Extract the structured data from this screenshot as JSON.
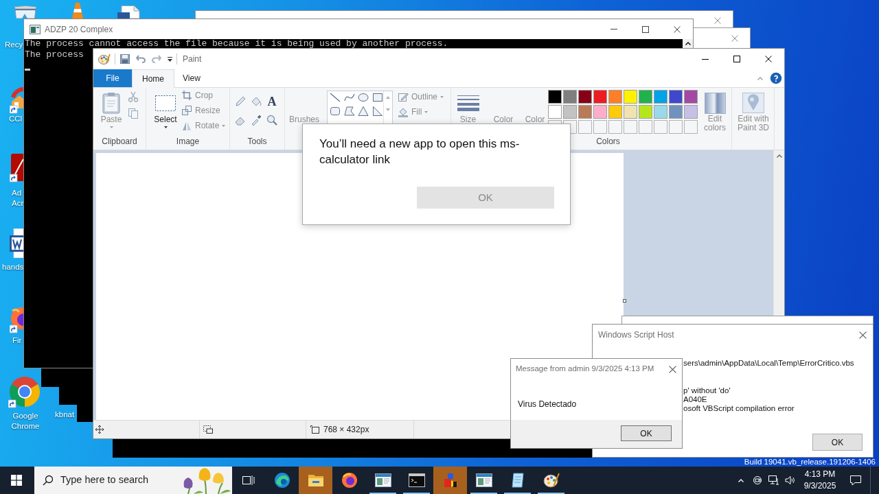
{
  "desktop": {
    "icons": [
      {
        "kind": "bin",
        "label_lines": [
          "Recy"
        ]
      },
      {
        "kind": "cone"
      },
      {
        "kind": "document"
      },
      {
        "kind": "cleaner",
        "label_lines": [
          "CCl"
        ]
      },
      {
        "kind": "pdf",
        "label_lines": [
          "Ad",
          "Acr"
        ]
      },
      {
        "kind": "word",
        "label_lines": [
          "hands"
        ]
      },
      {
        "kind": "fox",
        "label_lines": [
          "Fir"
        ]
      },
      {
        "kind": "chrome",
        "label_lines": [
          "Google",
          "Chrome"
        ]
      },
      {
        "kind": "file",
        "label_lines": [
          "kbnat"
        ]
      }
    ],
    "build_text": "Build 19041.vb_release.191206-1406"
  },
  "console": {
    "title": "ADZP 20 Complex",
    "lines": [
      "The process cannot access the file because it is being used by another process.",
      "The process"
    ]
  },
  "paint": {
    "title": "Paint",
    "file_tab": "File",
    "tabs": [
      {
        "label": "Home",
        "selected": true
      },
      {
        "label": "View",
        "selected": false
      }
    ],
    "clipboard": {
      "label": "Clipboard",
      "paste": {
        "label": "Paste",
        "disabled": true
      }
    },
    "image": {
      "label": "Image",
      "select": {
        "label": "Select",
        "disabled": false
      },
      "buttons": [
        {
          "kind": "crop",
          "label": "Crop",
          "disabled": true
        },
        {
          "kind": "resize",
          "label": "Resize",
          "disabled": true
        },
        {
          "kind": "rotate",
          "label": "Rotate",
          "disabled": true
        }
      ]
    },
    "tools": {
      "label": "Tools",
      "text_glyph": "A"
    },
    "brushes": {
      "label": "Brushes"
    },
    "shapes": {
      "buttons": [
        {
          "kind": "outline",
          "label": "Outline",
          "disabled": true
        },
        {
          "kind": "fill",
          "label": "Fill",
          "disabled": true
        }
      ]
    },
    "size": {
      "label": "Size"
    },
    "color_labels": [
      "Color",
      "Color"
    ],
    "colors": {
      "label": "Colors",
      "swatches": [
        {
          "color": "#000000"
        },
        {
          "color": "#7f7f7f"
        },
        {
          "color": "#880015"
        },
        {
          "color": "#ed1c24"
        },
        {
          "color": "#ff7f27"
        },
        {
          "color": "#fff200"
        },
        {
          "color": "#22b14c"
        },
        {
          "color": "#00a2e8"
        },
        {
          "color": "#3f48cc"
        },
        {
          "color": "#a349a4"
        },
        {
          "color": "#ffffff"
        },
        {
          "color": "#c3c3c3"
        },
        {
          "color": "#b97a57"
        },
        {
          "color": "#ffaec9"
        },
        {
          "color": "#ffc90e"
        },
        {
          "color": "#efe4b0"
        },
        {
          "color": "#b5e61d"
        },
        {
          "color": "#99d9ea"
        },
        {
          "color": "#7092be"
        },
        {
          "color": "#c8bfe7"
        }
      ]
    },
    "edit_colors": "Edit colors",
    "paint3d": "Edit with Paint 3D",
    "status": {
      "canvas_size": "768 × 432px"
    }
  },
  "app_dialog": {
    "message": "You’ll need a new app to open this ms-calculator link",
    "ok": {
      "label": "OK",
      "disabled": true
    }
  },
  "script_host": {
    "title": "Windows Script Host",
    "lines": [
      "sers\\admin\\AppData\\Local\\Temp\\ErrorCritico.vbs",
      "p' without 'do'",
      "A040E",
      "osoft VBScript compilation error"
    ],
    "button": "OK"
  },
  "message_box": {
    "title": "Message from admin 9/3/2025 4:13 PM",
    "text": "Virus Detectado",
    "button": "OK"
  },
  "taskbar": {
    "search_placeholder": "Type here to search",
    "apps": [
      {
        "kind": "globe",
        "running": false,
        "flashing": false
      },
      {
        "kind": "folder",
        "running": false,
        "flashing": true
      },
      {
        "kind": "fox",
        "running": false,
        "flashing": false
      },
      {
        "kind": "window",
        "running": true,
        "flashing": false
      },
      {
        "kind": "terminal",
        "running": true,
        "flashing": false
      },
      {
        "kind": "blocks",
        "running": false,
        "flashing": true
      },
      {
        "kind": "window",
        "running": true,
        "flashing": false
      },
      {
        "kind": "notepad",
        "running": true,
        "flashing": false
      },
      {
        "kind": "palette",
        "running": true,
        "flashing": false
      }
    ],
    "time": "4:13 PM",
    "date": "9/3/2025"
  }
}
